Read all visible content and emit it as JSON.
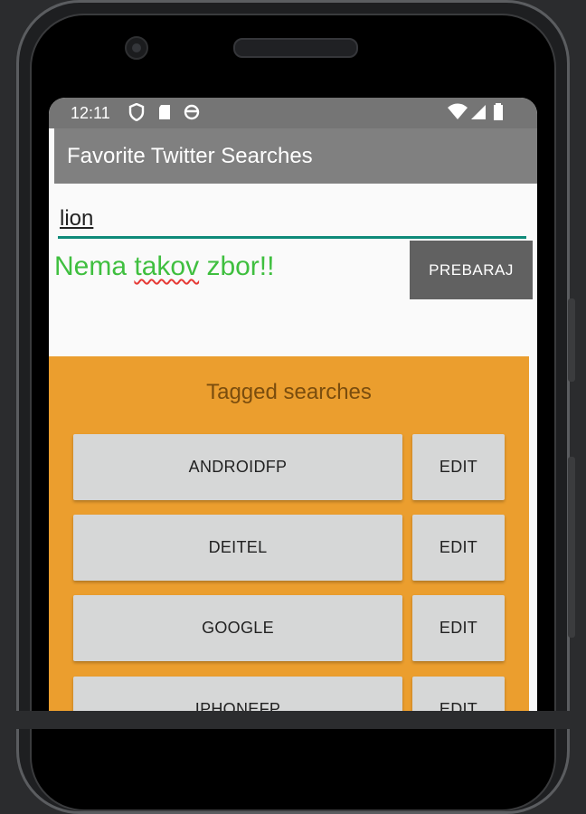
{
  "status_bar": {
    "time": "12:11",
    "left_icons": [
      "shield-icon",
      "sd-card-icon",
      "sync-icon"
    ],
    "right_icons": [
      "wifi-icon",
      "signal-icon",
      "battery-icon"
    ]
  },
  "app_bar": {
    "title": "Favorite Twitter Searches"
  },
  "search": {
    "query_value": "lion",
    "button_label": "PREBARAJ"
  },
  "result": {
    "word_1": "Nema",
    "word_2": "takov",
    "word_3": "zbor!!",
    "color": "#3fbf3f"
  },
  "tagged_searches": {
    "title": "Tagged searches",
    "background": "#eb9e2e",
    "items": [
      {
        "tag": "ANDROIDFP",
        "edit_label": "EDIT"
      },
      {
        "tag": "DEITEL",
        "edit_label": "EDIT"
      },
      {
        "tag": "GOOGLE",
        "edit_label": "EDIT"
      },
      {
        "tag": "IPHONEFP",
        "edit_label": "EDIT"
      }
    ]
  },
  "colors": {
    "status_bar": "#757575",
    "app_bar": "#808080",
    "accent": "#0e8a79",
    "search_button": "#616161"
  }
}
